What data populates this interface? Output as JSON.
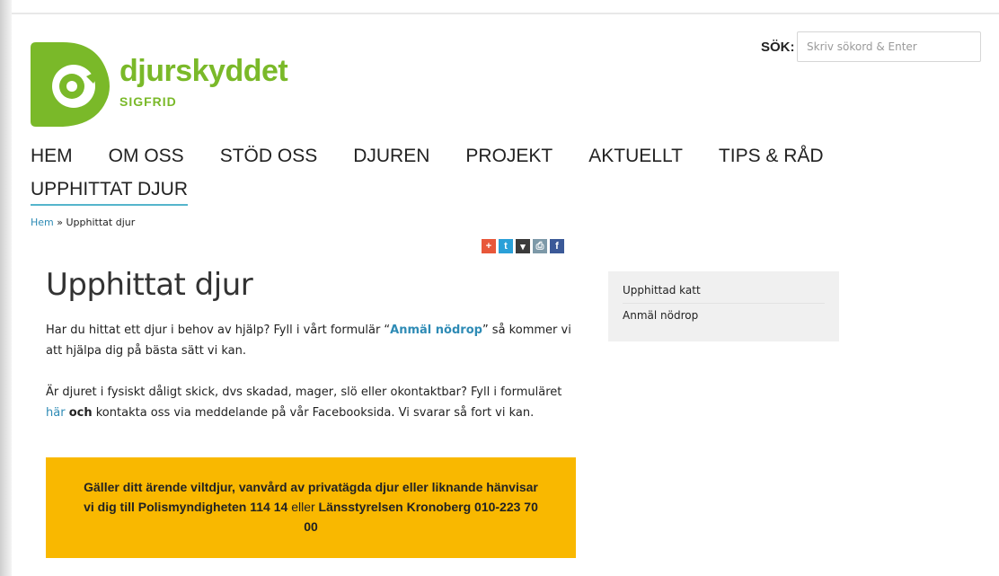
{
  "brand": {
    "name": "djurskyddet",
    "sub": "SIGFRID",
    "color": "#7ab929",
    "logo_icon": "logo-d-icon"
  },
  "search": {
    "label": "SÖK:",
    "placeholder": "Skriv sökord & Enter",
    "value": ""
  },
  "nav": {
    "items": [
      {
        "label": "HEM"
      },
      {
        "label": "OM OSS"
      },
      {
        "label": "STÖD OSS"
      },
      {
        "label": "DJUREN"
      },
      {
        "label": "PROJEKT"
      },
      {
        "label": "AKTUELLT"
      },
      {
        "label": "TIPS & RÅD"
      },
      {
        "label": "UPPHITTAT DJUR",
        "active": true
      }
    ],
    "active_color": "#55b5cc"
  },
  "breadcrumb": {
    "home": "Hem",
    "sep": " » ",
    "current": "Upphittat djur"
  },
  "share": {
    "plus": "+",
    "twitter": "t",
    "download": "▾",
    "print": "⎙",
    "facebook": "f"
  },
  "content": {
    "title": "Upphittat djur",
    "p1_before": "Har du hittat ett djur i behov av hjälp? Fyll i vårt formulär “",
    "p1_link": "Anmäl nödrop",
    "p1_after": "” så kommer vi att hjälpa dig på bästa sätt vi kan.",
    "p2_before": "Är djuret i fysiskt dåligt skick, dvs skadad, mager, slö eller okontaktbar? Fyll i formuläret ",
    "p2_link": "här",
    "p2_bold": "och",
    "p2_after": " kontakta oss via meddelande på vår Facebooksida. Vi svarar så fort vi kan."
  },
  "notice": {
    "text1": "Gäller ditt ärende viltdjur, vanvård av privatägda djur eller liknande hänvisar vi dig till Polismyndigheten 114 14 ",
    "normal": "eller",
    "text2": " Länsstyrelsen Kronoberg 010-223 70 00",
    "color": "#f9b800"
  },
  "sidebar": {
    "items": [
      {
        "label": "Upphittad katt"
      },
      {
        "label": "Anmäl nödrop"
      }
    ]
  }
}
